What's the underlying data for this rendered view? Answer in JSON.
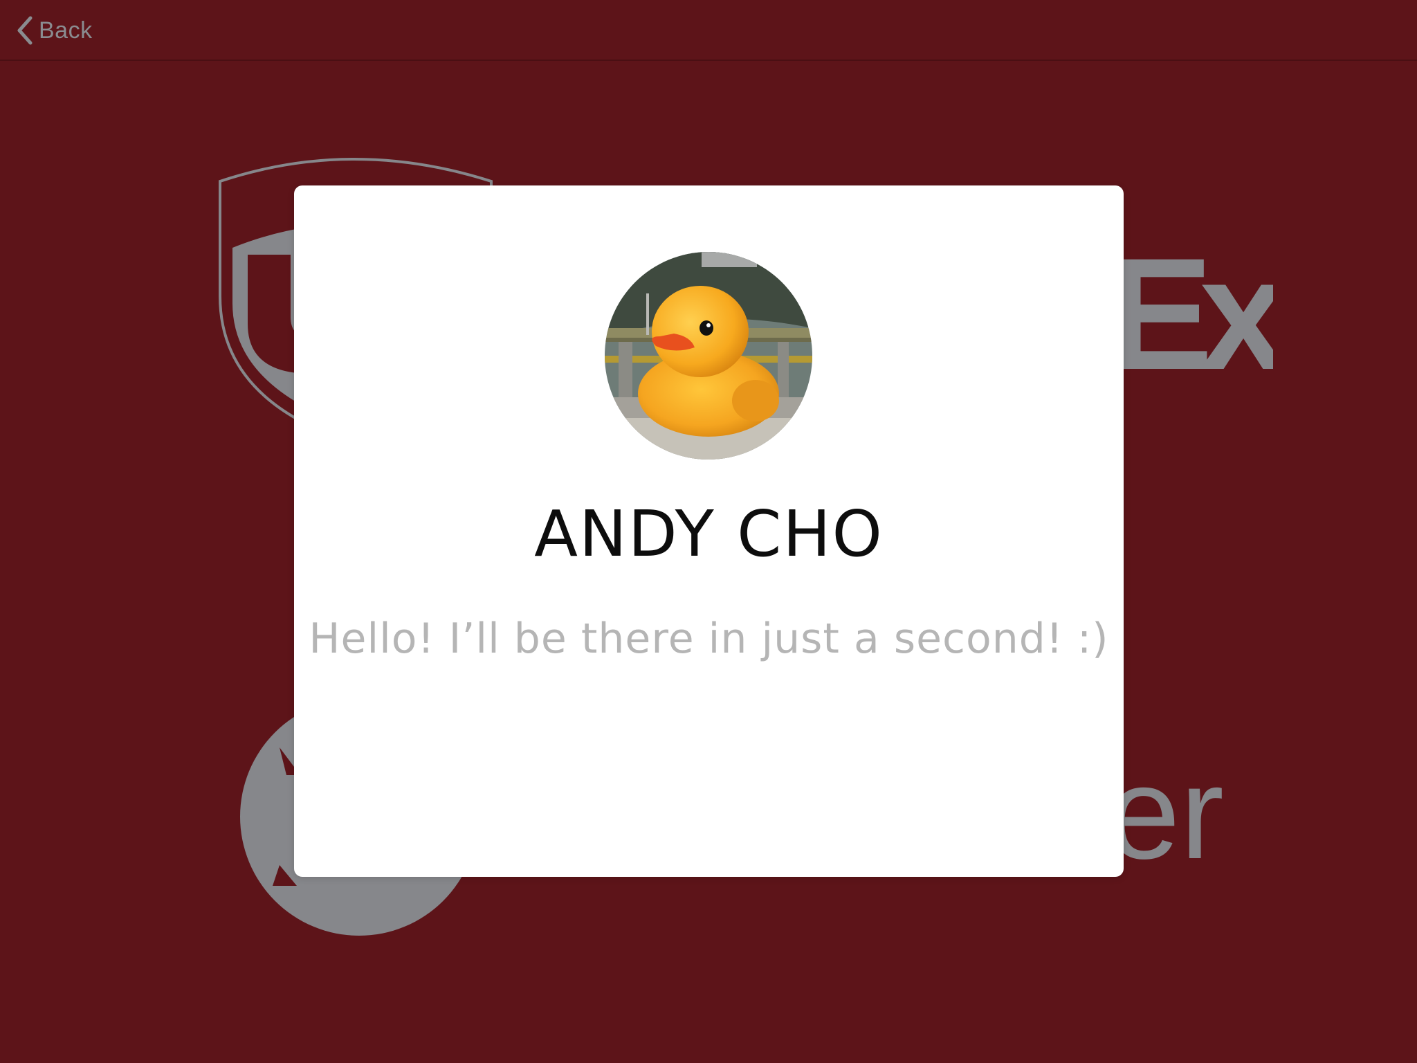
{
  "nav": {
    "back_label": "Back",
    "back_icon": "chevron-left-icon"
  },
  "background_logos": {
    "top_left": "shield-logo",
    "top_right": "Ex",
    "bottom_left": "circle-logo",
    "bottom_right": "er"
  },
  "modal": {
    "avatar": "rubber-duck-photo",
    "name": "ANDY CHO",
    "message": "Hello! I’ll be there in just a second! :)"
  },
  "colors": {
    "background": "#5d1419",
    "logo_gray": "#86878b",
    "modal_bg": "#ffffff",
    "name_color": "#0d0d0d",
    "message_color": "#b5b5b5"
  }
}
